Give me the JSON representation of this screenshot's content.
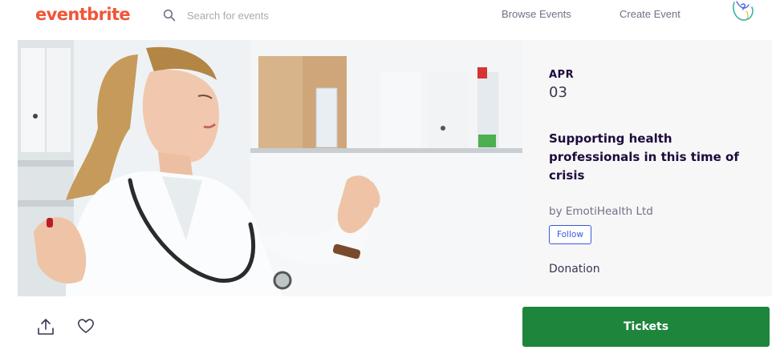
{
  "header": {
    "logo_text": "eventbrite",
    "search_placeholder": "Search for events",
    "nav": {
      "browse_events": "Browse Events",
      "create_event": "Create Event"
    }
  },
  "event": {
    "date_month": "APR",
    "date_day": "03",
    "title": "Supporting health professionals in this time of crisis",
    "organizer": "by EmotiHealth Ltd",
    "follow_label": "Follow",
    "price": "Donation"
  },
  "actions": {
    "share_icon": "share-icon",
    "like_icon": "heart-icon",
    "tickets_label": "Tickets"
  },
  "colors": {
    "brand": "#f05537",
    "tickets_green": "#1e853c",
    "follow_blue": "#3659e3",
    "panel_bg": "#f7f7f8"
  }
}
